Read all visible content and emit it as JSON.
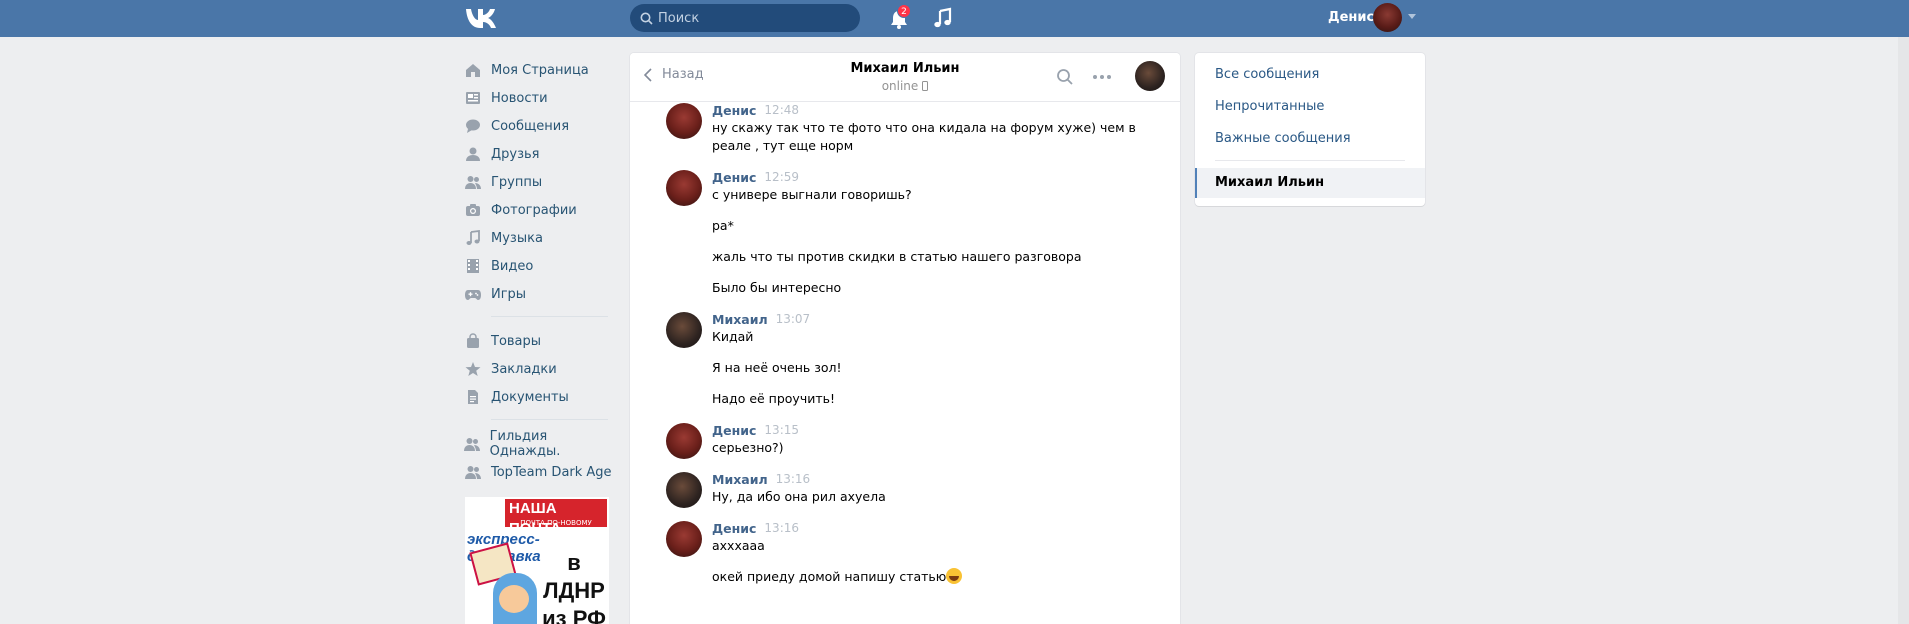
{
  "header": {
    "search_placeholder": "Поиск",
    "notifications_count": "2",
    "user_name": "Денис"
  },
  "nav": {
    "main": [
      {
        "icon": "home-icon",
        "label": "Моя Страница"
      },
      {
        "icon": "news-icon",
        "label": "Новости"
      },
      {
        "icon": "messages-icon",
        "label": "Сообщения"
      },
      {
        "icon": "friend-icon",
        "label": "Друзья"
      },
      {
        "icon": "groups-icon",
        "label": "Группы"
      },
      {
        "icon": "camera-icon",
        "label": "Фотографии"
      },
      {
        "icon": "music-note-icon",
        "label": "Музыка"
      },
      {
        "icon": "video-icon",
        "label": "Видео"
      },
      {
        "icon": "gamepad-icon",
        "label": "Игры"
      }
    ],
    "secondary": [
      {
        "icon": "bag-icon",
        "label": "Товары"
      },
      {
        "icon": "star-icon",
        "label": "Закладки"
      },
      {
        "icon": "document-icon",
        "label": "Документы"
      }
    ],
    "groups": [
      {
        "icon": "group-icon",
        "label": "Гильдия Однажды."
      },
      {
        "icon": "group-icon",
        "label": "TopTeam Dark Age"
      }
    ]
  },
  "ad": {
    "brand": "НАША ПОЧТА",
    "tagline": "ПОЧТА ПО-НОВОМУ",
    "headline": "экспресс-доставка",
    "region_line1": "в ЛДНР",
    "region_line2": "из РФ"
  },
  "chat": {
    "back_label": "Назад",
    "peer_name": "Михаил Ильин",
    "peer_status": "online",
    "messages": [
      {
        "author": "Денис",
        "avatar": "d",
        "time": "12:48",
        "lines": [
          "ну скажу так что те фото что она кидала на форум хуже) чем в",
          "реале , тут еще норм"
        ],
        "compact": true
      },
      {
        "author": "Денис",
        "avatar": "d",
        "time": "12:59",
        "lines": [
          "с универе выгнали говоришь?",
          "ра*",
          "жаль что ты против скидки в статью нашего разговора",
          "Было бы интересно"
        ]
      },
      {
        "author": "Михаил",
        "avatar": "m",
        "time": "13:07",
        "lines": [
          "Кидай",
          "Я на неё очень зол!",
          "Надо её проучить!"
        ]
      },
      {
        "author": "Денис",
        "avatar": "d",
        "time": "13:15",
        "lines": [
          "серьезно?)"
        ]
      },
      {
        "author": "Михаил",
        "avatar": "m",
        "time": "13:16",
        "lines": [
          "Ну, да ибо она рил ахуела"
        ]
      },
      {
        "author": "Денис",
        "avatar": "d",
        "time": "13:16",
        "lines": [
          "ахххааа",
          "окей приеду домой напишу статью"
        ],
        "emoji_after_last": "grinning-face"
      }
    ]
  },
  "right_panel": {
    "all_messages": "Все сообщения",
    "unread": "Непрочитанные",
    "important": "Важные сообщения",
    "active_dialog": "Михаил Ильин"
  },
  "colors": {
    "header_bg": "#4a76a8",
    "link": "#2a5885",
    "author": "#42648b",
    "badge": "#ff3347"
  }
}
